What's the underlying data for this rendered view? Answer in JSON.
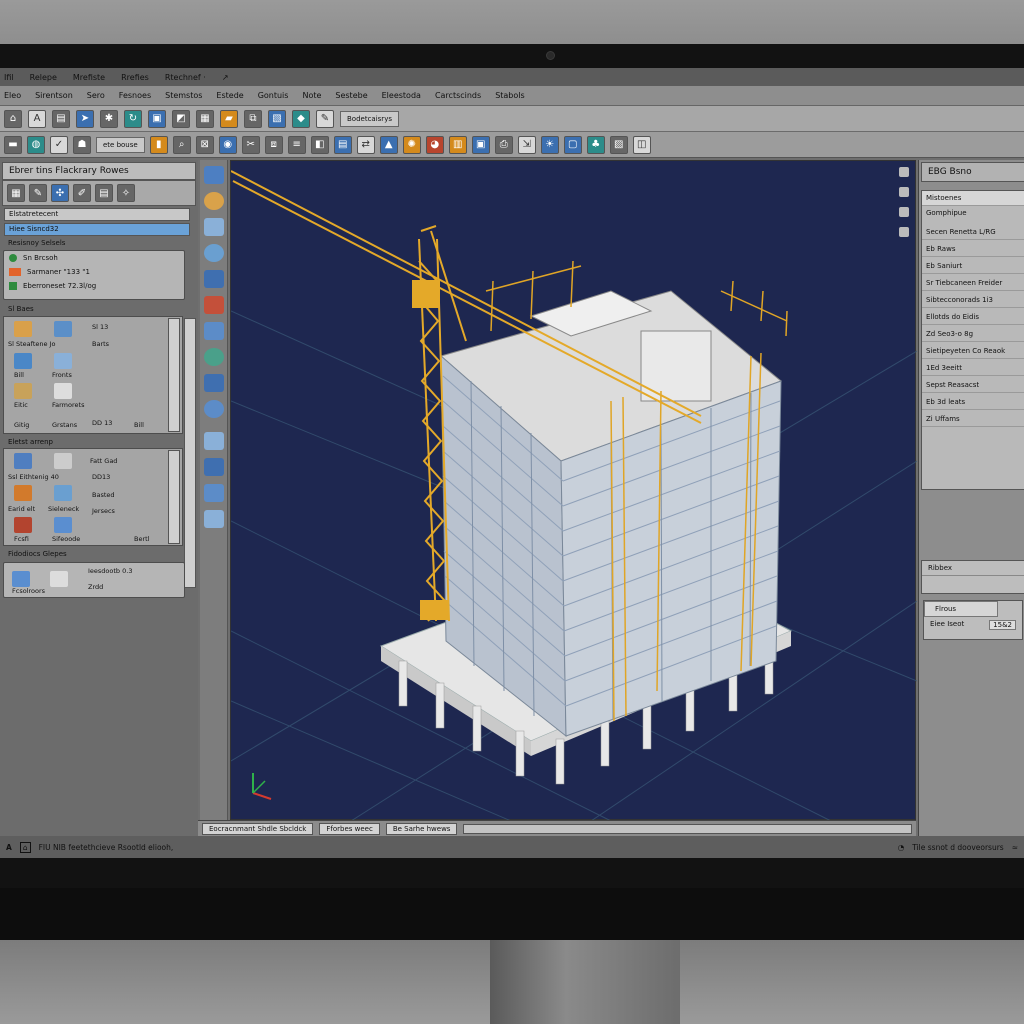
{
  "menubar": {
    "items": [
      "Ifil",
      "Relepe",
      "Mrefiste",
      "Rrefies",
      "Rtechnef ·",
      "↗"
    ]
  },
  "ribbon_tabs": [
    "Eleo",
    "Sirentson",
    "Sero",
    "Fesnoes",
    "Stemstos",
    "Estede",
    "Gontuis",
    "Note",
    "Sestebe",
    "Eleestoda",
    "Carctscinds",
    "Stabols"
  ],
  "toolbar": {
    "field1": "Bodetcaisrys",
    "field2": "ete bouse"
  },
  "left_panel": {
    "title": "Ebrer tins Flackrary Rowes",
    "field1": "Elstatretecent",
    "field2_selected": "Hiee Sisncd32",
    "group1_title": "Resisnoy Selsels",
    "group1_rows": [
      "Sn Brcsoh",
      "Sarmaner \"133 \"1",
      "Eberroneset 72.3l/og"
    ],
    "group2_title": "Sl Baes",
    "group2_items": [
      "Sl Steaftene Jo",
      "Bill",
      "Eitic",
      "Fronts",
      "Gitig",
      "Bill",
      "Farmorets",
      "Grstans",
      "Sl 13",
      "DD 13",
      "Barts"
    ],
    "group3_title": "Eletst arrenp",
    "group3_items": [
      "Fatt Gad",
      "Ssl Eithtenig 40",
      "DD13",
      "Bertl",
      "Sieleneck",
      "Basted",
      "Earid elt",
      "Fcsfi",
      "Sifeoode",
      "Jersecs"
    ],
    "group4_title": "Fidodiocs Glepes",
    "group4_rows": [
      "Ieesdootb 0.3",
      "Fcsolroors",
      "Zrdd"
    ]
  },
  "viewport_tabs": [
    "Eocracnmant Shdle Sbcldck",
    "Fforbes weec",
    "Be Sarhe hwews"
  ],
  "right_panel": {
    "title": "EBG Bsno",
    "list_header": "Mistoenes",
    "subheader": "Gomphipue",
    "rows": [
      "Secen Renetta L/RG",
      "Eb Raws",
      "Eb Saniurt",
      "Sr Tiebcaneen Freider",
      "Sibtecconorads 1i3",
      "Ellotds do Eidis",
      "Zd Seo3-o 8g",
      "Sietipeyeten Co Reaok",
      "1Ed 3eeitt",
      "Sepst Reasacst",
      "Eb 3d leats",
      "Zi Uffams"
    ],
    "box2_label": "Ribbex",
    "box3_tab": "Flrous",
    "box3_field": "Eiee Iseot",
    "box3_value": "15&2"
  },
  "statusbar": {
    "left_text": "FIU NIB feetethcieve Rsootld eliooh,",
    "right_text": "Tile ssnot d dooveorsurs"
  }
}
